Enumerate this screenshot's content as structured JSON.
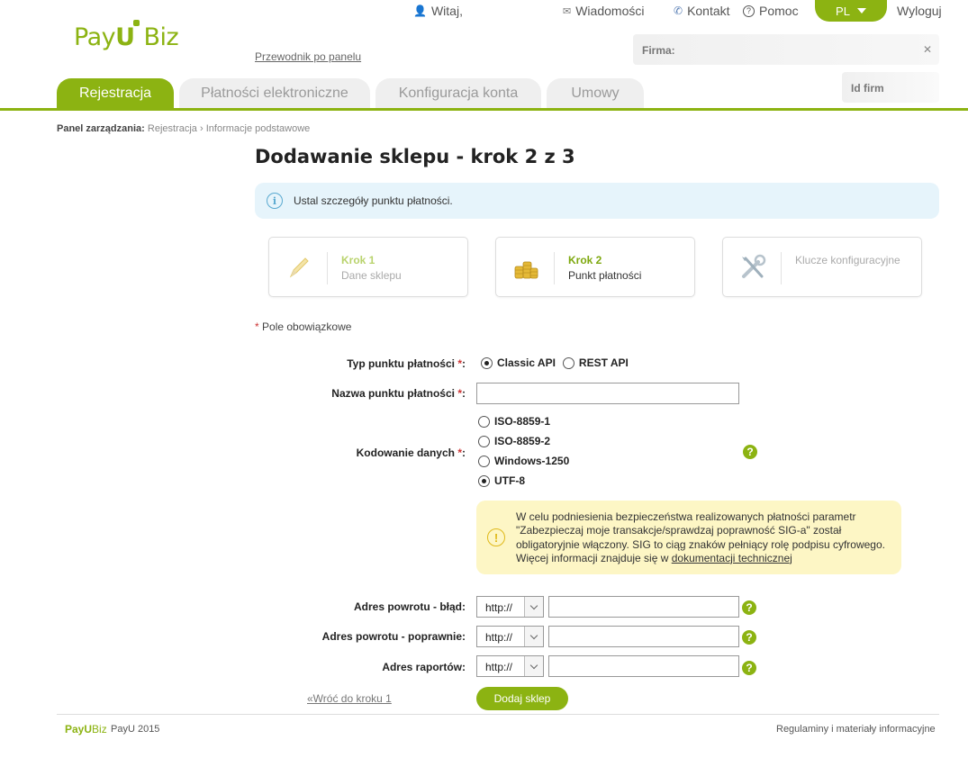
{
  "header": {
    "logo_pay": "Pay",
    "logo_u": "U",
    "logo_biz": "Biz",
    "greeting": "Witaj,",
    "messages": "Wiadomości",
    "contact": "Kontakt",
    "help": "Pomoc",
    "language": "PL",
    "logout": "Wyloguj",
    "guide_link": "Przewodnik po panelu",
    "firma_label": "Firma:",
    "id_label": "Id firm"
  },
  "tabs": [
    {
      "label": "Rejestracja",
      "active": true
    },
    {
      "label": "Płatności elektroniczne",
      "active": false
    },
    {
      "label": "Konfiguracja konta",
      "active": false
    },
    {
      "label": "Umowy",
      "active": false
    }
  ],
  "breadcrumb": {
    "root": "Panel zarządzania:",
    "level1": "Rejestracja",
    "sep": "›",
    "level2": "Informacje podstawowe"
  },
  "page": {
    "title": "Dodawanie sklepu - krok 2 z 3",
    "info_text": "Ustal szczegóły punktu płatności.",
    "required_note": "Pole obowiązkowe",
    "required_mark": "*"
  },
  "steps": [
    {
      "title": "Krok 1",
      "subtitle": "Dane sklepu",
      "state": "done",
      "icon": "pencil-icon"
    },
    {
      "title": "Krok 2",
      "subtitle": "Punkt płatności",
      "state": "current",
      "icon": "coins-icon"
    },
    {
      "title": "Klucze konfiguracyjne",
      "subtitle": "",
      "state": "next",
      "icon": "tools-icon"
    }
  ],
  "form": {
    "type_label": "Typ punktu płatności",
    "type_options": [
      "Classic API",
      "REST API"
    ],
    "type_selected": "Classic API",
    "name_label": "Nazwa punktu płatności",
    "name_value": "",
    "encoding_label": "Kodowanie danych",
    "encoding_options": [
      "ISO-8859-1",
      "ISO-8859-2",
      "Windows-1250",
      "UTF-8"
    ],
    "encoding_selected": "UTF-8",
    "warning_line1": "W celu podniesienia bezpieczeństwa realizowanych płatności parametr",
    "warning_line2": "\"Zabezpieczaj moje transakcje/sprawdzaj poprawność SIG-a\" został",
    "warning_line3": "obligatoryjnie włączony. SIG to ciąg znaków pełniący rolę podpisu cyfrowego.",
    "warning_line4_prefix": "Więcej informacji znajduje się w ",
    "warning_link": "dokumentacji technicznej",
    "return_error_label": "Adres powrotu - błąd:",
    "return_ok_label": "Adres powrotu - poprawnie:",
    "reports_label": "Adres raportów:",
    "protocol": "http://",
    "back_link": "«Wróć do kroku 1",
    "submit": "Dodaj sklep"
  },
  "footer": {
    "logo_pay": "PayU",
    "logo_biz": "Biz",
    "copyright": "PayU 2015",
    "terms": "Regulaminy i materiały informacyjne"
  },
  "colors": {
    "brand_green": "#8cb312",
    "info_bg": "#e6f4fb",
    "warning_bg": "#fdf6c5",
    "required": "#cc3333"
  }
}
